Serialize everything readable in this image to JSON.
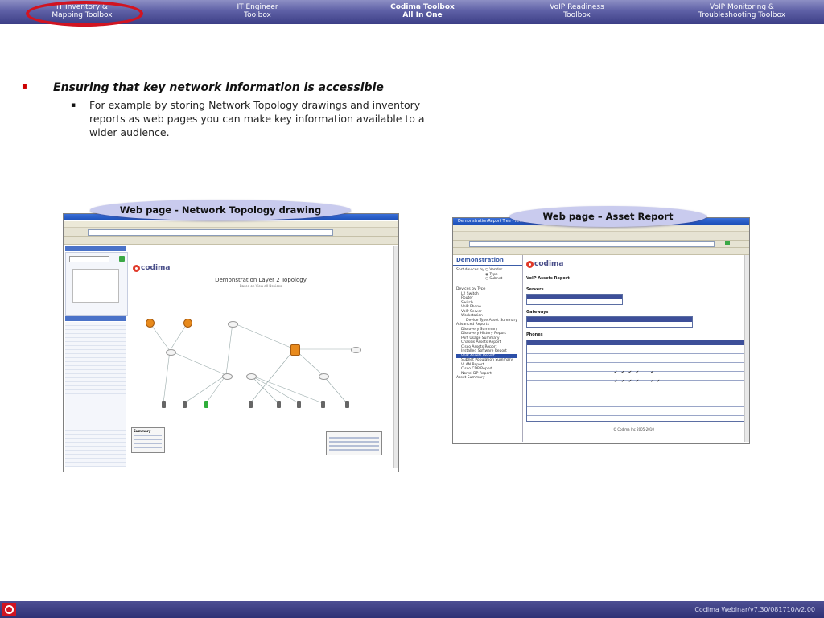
{
  "nav": {
    "tabs": [
      {
        "line1": "IT Inventory &",
        "line2": "Mapping Toolbox"
      },
      {
        "line1": "IT Engineer",
        "line2": "Toolbox"
      },
      {
        "line1": "Codima Toolbox",
        "line2": "All In One"
      },
      {
        "line1": "VoIP Readiness",
        "line2": "Toolbox"
      },
      {
        "line1": "VoIP Monitoring &",
        "line2": "Troubleshooting Toolbox"
      }
    ],
    "active_tab": "Codima Toolbox",
    "highlight_color": "#d11421"
  },
  "content": {
    "bullet1": "Ensuring that key network information is accessible",
    "bullet2": "For example by storing Network Topology drawings and inventory reports as web pages you can make key information available to a wider audience."
  },
  "callouts": {
    "topology": "Web page - Network Topology drawing",
    "asset": "Web page – Asset Report"
  },
  "topology_shot": {
    "brand": "codima",
    "diagram_title": "Demonstration Layer 2 Topology",
    "diagram_subtitle": "Based on View all Devices",
    "summary_label": "Summary"
  },
  "asset_shot": {
    "window_title": "DemonstrationReport Tree - Microsoft Internet Explorer",
    "brand": "codima",
    "sidebar_title": "Demonstration",
    "sort_label": "Sort devices by :",
    "sort_options": [
      "Vendor",
      "Type",
      "Subnet"
    ],
    "report_title": "VoIP Assets Report",
    "sections": [
      "Servers",
      "Gateways",
      "Phones"
    ],
    "tree": [
      "Devices by Type",
      "L2 Switch",
      "Router",
      "Switch",
      "VoIP Phone",
      "VoIP Server",
      "Workstation",
      "Device Type Asset Summary",
      "Advanced Reports",
      "Discovery Summary",
      "Discovery History Report",
      "Port Usage Summary",
      "Chassis Assets Report",
      "Cisco Assets Report",
      "Installed Software Report",
      "VoIP Assets Report",
      "Subnet Population Summary",
      "VLAN Report",
      "Cisco CDP Report",
      "Nortel DP Report",
      "Asset Summary"
    ],
    "footer": "© Codima Inc 2005-2010"
  },
  "footer": {
    "text": "Codima Webinar/v7.30/081710/v2.00",
    "bar_color": "#3b3d80"
  }
}
